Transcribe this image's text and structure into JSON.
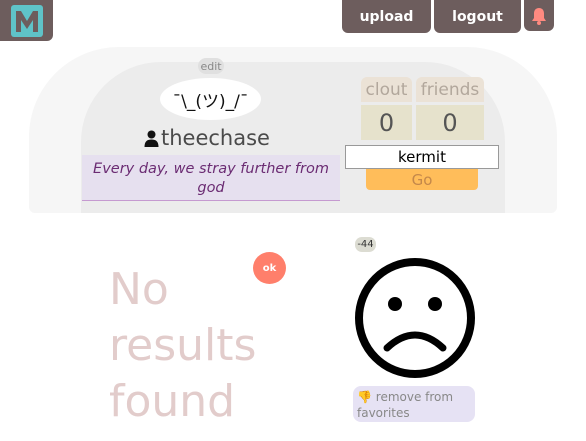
{
  "header": {
    "logo_letter": "M",
    "upload_label": "upload",
    "logout_label": "logout",
    "bell_icon": "bell-icon"
  },
  "profile": {
    "edit_label": "edit",
    "avatar_text": "¯\\_(ツ)_/¯",
    "username": "theechase",
    "user_icon": "user-icon",
    "bio": "Every day, we stray further from god",
    "stats": {
      "clout_label": "clout",
      "clout_value": "0",
      "friends_label": "friends",
      "friends_value": "0"
    },
    "search_value": "kermit",
    "go_label": "Go"
  },
  "results": {
    "no_results_text": "No results found",
    "ok_label": "ok",
    "score": "-44",
    "face_icon": "sad-face-icon",
    "fav_icon": "thumbs-down-icon",
    "fav_emoji": "👎",
    "remove_label": "remove from favorites"
  },
  "colors": {
    "header_bg": "#6d5d5d",
    "logo_accent": "#5fc3c8",
    "bell_color": "#ff8a80",
    "bio_text": "#6b2c73",
    "go_bg": "#ffbd5a",
    "ok_bg": "#ff7f6b",
    "no_results_text": "#e2cccb"
  }
}
